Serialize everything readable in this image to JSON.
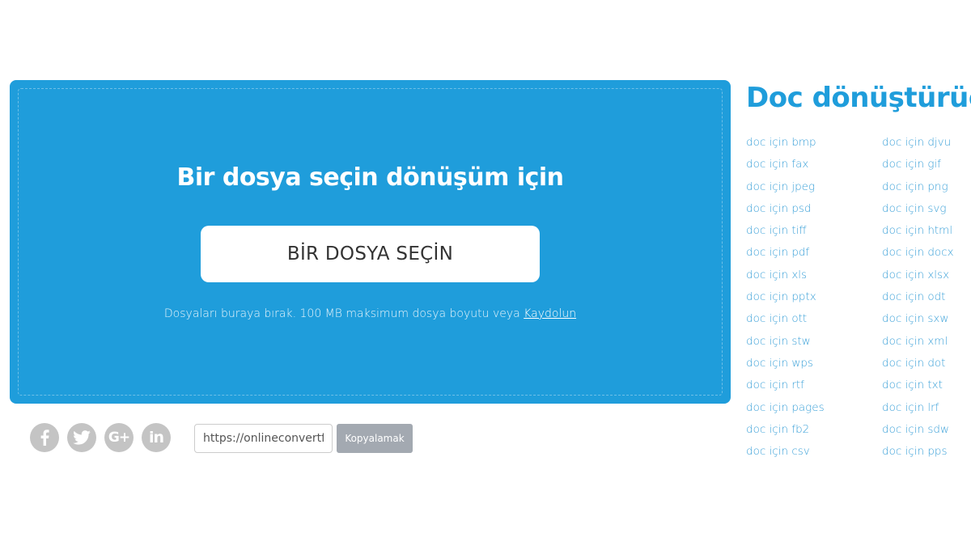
{
  "upload": {
    "title": "Bir dosya seçin dönüşüm için",
    "choose_button_label": "BİR DOSYA SEÇİN",
    "hint_text": "Dosyaları buraya bırak. 100 MB maksimum dosya boyutu veya ",
    "register_link": "Kaydolun"
  },
  "share": {
    "social": [
      {
        "name": "facebook",
        "icon": "facebook-icon"
      },
      {
        "name": "twitter",
        "icon": "twitter-icon"
      },
      {
        "name": "google-plus",
        "icon": "google-plus-icon"
      },
      {
        "name": "linkedin",
        "icon": "linkedin-icon"
      }
    ],
    "url_value": "https://onlineconvertfree.com",
    "copy_label": "Kopyalamak"
  },
  "converter": {
    "title": "Doc dönüştürücü",
    "links": [
      "doc için bmp",
      "doc için djvu",
      "doc için fax",
      "doc için gif",
      "doc için jpeg",
      "doc için png",
      "doc için psd",
      "doc için svg",
      "doc için tiff",
      "doc için html",
      "doc için pdf",
      "doc için docx",
      "doc için xls",
      "doc için xlsx",
      "doc için pptx",
      "doc için odt",
      "doc için ott",
      "doc için sxw",
      "doc için stw",
      "doc için xml",
      "doc için wps",
      "doc için dot",
      "doc için rtf",
      "doc için txt",
      "doc için pages",
      "doc için lrf",
      "doc için fb2",
      "doc için sdw",
      "doc için csv",
      "doc için pps"
    ]
  },
  "colors": {
    "accent": "#1f9ddb",
    "link": "#3aa0d8",
    "social_gray": "#c4c4c4",
    "copy_button": "#a3a9b1"
  }
}
